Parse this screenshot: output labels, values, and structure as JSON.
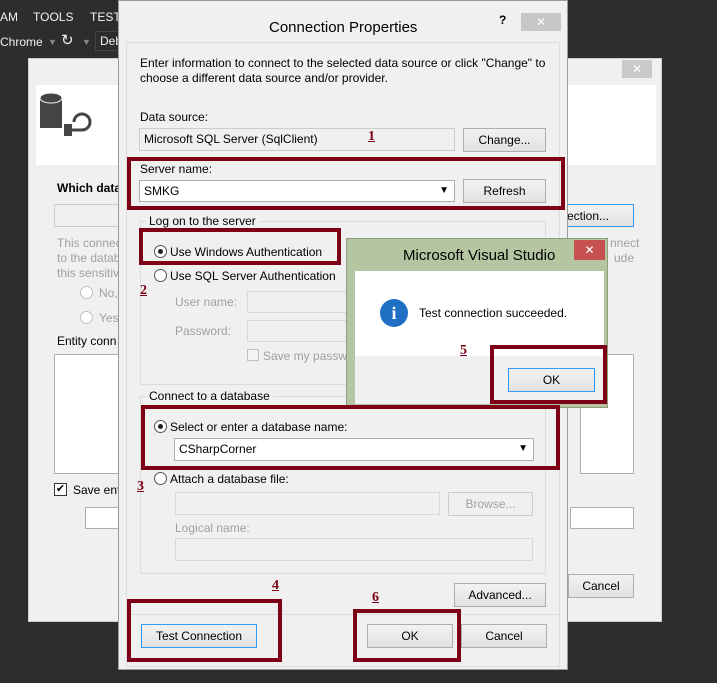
{
  "ide": {
    "menu": [
      "AM",
      "TOOLS",
      "TEST"
    ],
    "toolbar": {
      "browser": "Chrome",
      "debug": "Deb"
    }
  },
  "back_dialog": {
    "question": "Which data",
    "desc": [
      "This connec",
      "to the datab",
      "this sensitiv"
    ],
    "radio_no": "No,",
    "radio_yes": "Yes,",
    "entity_label": "Entity conn",
    "save_label": "Save ent",
    "new_connection": "ection...",
    "desc_right": [
      "nnect",
      "ude"
    ],
    "cancel": "Cancel",
    "close": "✕"
  },
  "conn": {
    "title": "Connection Properties",
    "help": "?",
    "close": "✕",
    "intro": "Enter information to connect to the selected data source or click \"Change\" to choose a different data source and/or provider.",
    "data_source_label": "Data source:",
    "data_source": "Microsoft SQL Server (SqlClient)",
    "change": "Change...",
    "server_label": "Server name:",
    "server": "SMKG",
    "refresh": "Refresh",
    "logon_group": "Log on to the server",
    "windows_auth": "Use Windows Authentication",
    "sql_auth": "Use SQL Server Authentication",
    "user_label": "User name:",
    "password_label": "Password:",
    "save_password": "Save my password",
    "db_group": "Connect to a database",
    "select_db": "Select or enter a database name:",
    "database": "CSharpCorner",
    "attach": "Attach a database file:",
    "browse": "Browse...",
    "logical": "Logical name:",
    "advanced": "Advanced...",
    "test": "Test Connection",
    "ok": "OK",
    "cancel": "Cancel"
  },
  "msgbox": {
    "title": "Microsoft Visual Studio",
    "message": "Test connection succeeded.",
    "ok": "OK",
    "close": "✕"
  },
  "annotations": [
    "1",
    "2",
    "3",
    "4",
    "5",
    "6"
  ]
}
